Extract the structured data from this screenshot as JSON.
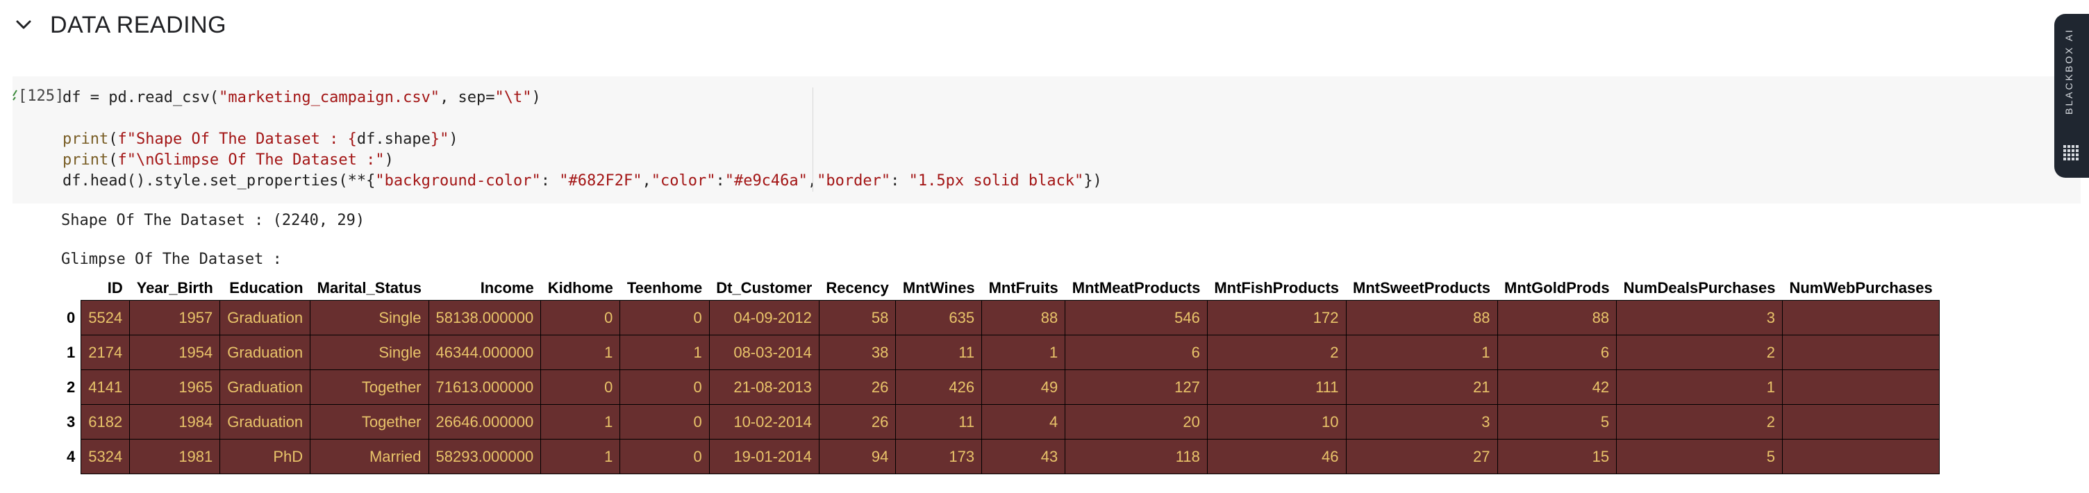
{
  "section": {
    "title": "DATA READING"
  },
  "cell": {
    "execution_count": "[125]",
    "code_lines": [
      [
        "df = pd.read_csv(",
        {
          "s": "\"marketing_campaign.csv\""
        },
        ", sep=",
        {
          "s": "\"\\t\""
        },
        ")"
      ],
      [],
      [
        {
          "f": "print"
        },
        "(",
        {
          "s": "f\"Shape Of The Dataset : {"
        },
        "df.shape",
        {
          "s": "}\""
        },
        ")"
      ],
      [
        {
          "f": "print"
        },
        "(",
        {
          "s": "f\"\\nGlimpse Of The Dataset :\""
        },
        ")"
      ],
      [
        "df.head().style.set_properties(**{",
        {
          "s": "\"background-color\""
        },
        ": ",
        {
          "s": "\"#682F2F\""
        },
        ",",
        {
          "s": "\"color\""
        },
        ":",
        {
          "s": "\"#e9c46a\""
        },
        ",",
        {
          "s": "\"border\""
        },
        ": ",
        {
          "s": "\"1.5px solid black\""
        },
        "})"
      ]
    ]
  },
  "output": {
    "shape_line": "Shape Of The Dataset : (2240, 29)",
    "glimpse_line": "Glimpse Of The Dataset :"
  },
  "table": {
    "columns": [
      "ID",
      "Year_Birth",
      "Education",
      "Marital_Status",
      "Income",
      "Kidhome",
      "Teenhome",
      "Dt_Customer",
      "Recency",
      "MntWines",
      "MntFruits",
      "MntMeatProducts",
      "MntFishProducts",
      "MntSweetProducts",
      "MntGoldProds",
      "NumDealsPurchases",
      "NumWebPurchases"
    ],
    "rows": [
      {
        "index": "0",
        "cells": [
          "5524",
          "1957",
          "Graduation",
          "Single",
          "58138.000000",
          "0",
          "0",
          "04-09-2012",
          "58",
          "635",
          "88",
          "546",
          "172",
          "88",
          "88",
          "3",
          ""
        ]
      },
      {
        "index": "1",
        "cells": [
          "2174",
          "1954",
          "Graduation",
          "Single",
          "46344.000000",
          "1",
          "1",
          "08-03-2014",
          "38",
          "11",
          "1",
          "6",
          "2",
          "1",
          "6",
          "2",
          ""
        ]
      },
      {
        "index": "2",
        "cells": [
          "4141",
          "1965",
          "Graduation",
          "Together",
          "71613.000000",
          "0",
          "0",
          "21-08-2013",
          "26",
          "426",
          "49",
          "127",
          "111",
          "21",
          "42",
          "1",
          ""
        ]
      },
      {
        "index": "3",
        "cells": [
          "6182",
          "1984",
          "Graduation",
          "Together",
          "26646.000000",
          "1",
          "0",
          "10-02-2014",
          "26",
          "11",
          "4",
          "20",
          "10",
          "3",
          "5",
          "2",
          ""
        ]
      },
      {
        "index": "4",
        "cells": [
          "5324",
          "1981",
          "PhD",
          "Married",
          "58293.000000",
          "1",
          "0",
          "19-01-2014",
          "94",
          "173",
          "43",
          "118",
          "46",
          "27",
          "15",
          "5",
          ""
        ]
      }
    ]
  },
  "sidebar_tab": {
    "label": "BLACKBOX AI"
  },
  "colors": {
    "cell_bg": "#682F2F",
    "cell_text": "#e9c46a",
    "string": "#a31515",
    "function": "#795e26"
  },
  "icons": {
    "collapse": "chevron-down-icon",
    "assistant": "blackbox-logo-icon"
  }
}
